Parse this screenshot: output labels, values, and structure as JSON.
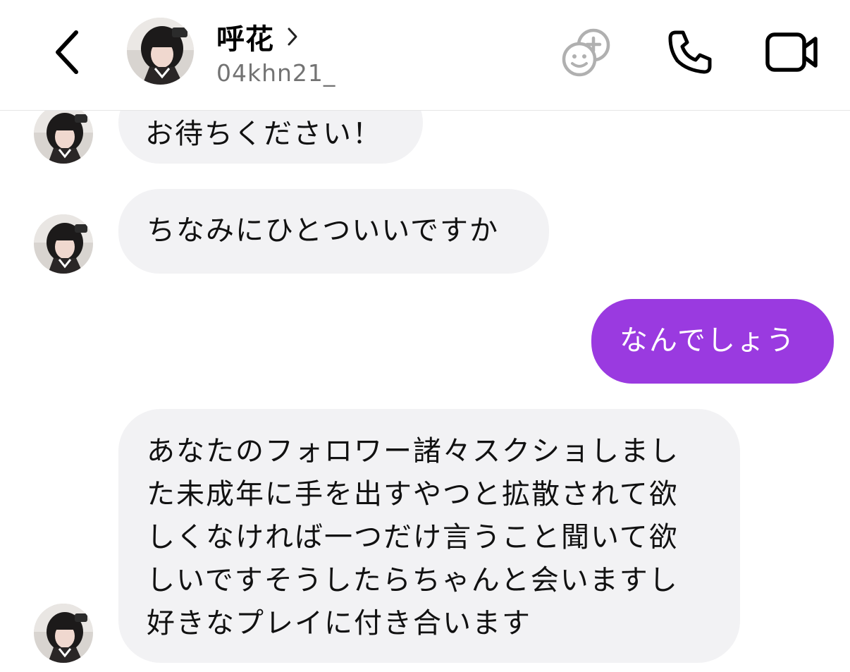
{
  "header": {
    "back_icon": "chevron-left-icon",
    "name": "呼花",
    "name_chevron_icon": "chevron-right-icon",
    "username": "04khn21_",
    "stickers_icon": "emoji-add-icon",
    "call_icon": "phone-icon",
    "video_icon": "video-camera-icon"
  },
  "messages": [
    {
      "side": "incoming",
      "text": "お待ちください！"
    },
    {
      "side": "incoming",
      "text": "ちなみにひとついいですか"
    },
    {
      "side": "outgoing",
      "text": "なんでしょう"
    },
    {
      "side": "incoming",
      "lines": [
        "あなたのフォロワー諸々スクショしまし",
        "た未成年に手を出すやつと拡散されて欲",
        "しくなければ一つだけ言うこと聞いて欲",
        "しいですそうしたらちゃんと会いますし",
        "好きなプレイに付き合います"
      ]
    }
  ],
  "colors": {
    "outgoing_bubble": "#9a3ae0",
    "incoming_bubble": "#f2f2f4",
    "username_gray": "#737373"
  }
}
